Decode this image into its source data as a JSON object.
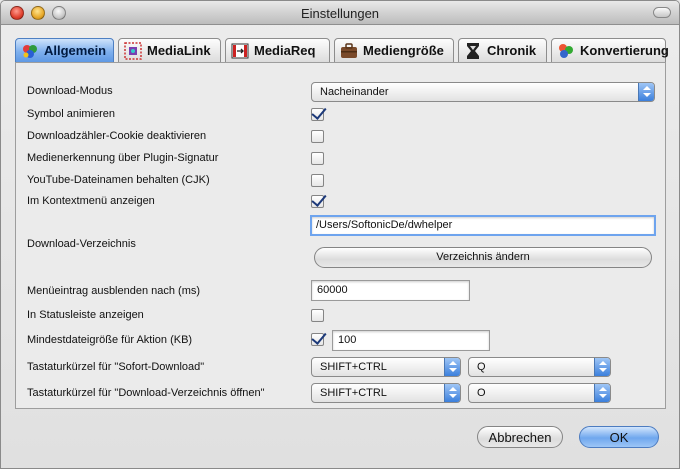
{
  "window": {
    "title": "Einstellungen",
    "colors": {
      "accent": "#5e98e4",
      "check": "#1d3a7a"
    }
  },
  "tabs": [
    {
      "label": "Allgemein",
      "icon": "palette-icon",
      "active": true
    },
    {
      "label": "MediaLink",
      "icon": "link-grid-icon",
      "active": false
    },
    {
      "label": "MediaReq",
      "icon": "film-icon",
      "active": false
    },
    {
      "label": "Mediengröße",
      "icon": "briefcase-icon",
      "active": false
    },
    {
      "label": "Chronik",
      "icon": "clock-icon",
      "active": false
    },
    {
      "label": "Konvertierung",
      "icon": "color-balls-icon",
      "active": false
    }
  ],
  "settings": {
    "download_mode": {
      "label": "Download-Modus",
      "value": "Nacheinander"
    },
    "animate_icon": {
      "label": "Symbol animieren",
      "checked": true
    },
    "counter_cookie": {
      "label": "Downloadzähler-Cookie deaktivieren",
      "checked": false
    },
    "plugin_signature": {
      "label": "Medienerkennung über Plugin-Signatur",
      "checked": false
    },
    "youtube_names": {
      "label": "YouTube-Dateinamen behalten (CJK)",
      "checked": false
    },
    "context_menu": {
      "label": "Im Kontextmenü anzeigen",
      "checked": true
    },
    "download_dir": {
      "label": "Download-Verzeichnis",
      "value": "/Users/SoftonicDe/dwhelper",
      "change_label": "Verzeichnis ändern"
    },
    "hide_menu": {
      "label": "Menüeintrag ausblenden nach (ms)",
      "value": "60000"
    },
    "statusbar": {
      "label": "In Statusleiste anzeigen",
      "checked": false
    },
    "min_size": {
      "label": "Mindestdateigröße für Aktion (KB)",
      "checked": true,
      "value": "100"
    },
    "shortcut_download": {
      "label": "Tastaturkürzel für \"Sofort-Download\"",
      "modifier": "SHIFT+CTRL",
      "key": "Q"
    },
    "shortcut_open_dir": {
      "label": "Tastaturkürzel für \"Download-Verzeichnis öffnen\"",
      "modifier": "SHIFT+CTRL",
      "key": "O"
    }
  },
  "footer": {
    "cancel_label": "Abbrechen",
    "ok_label": "OK"
  }
}
